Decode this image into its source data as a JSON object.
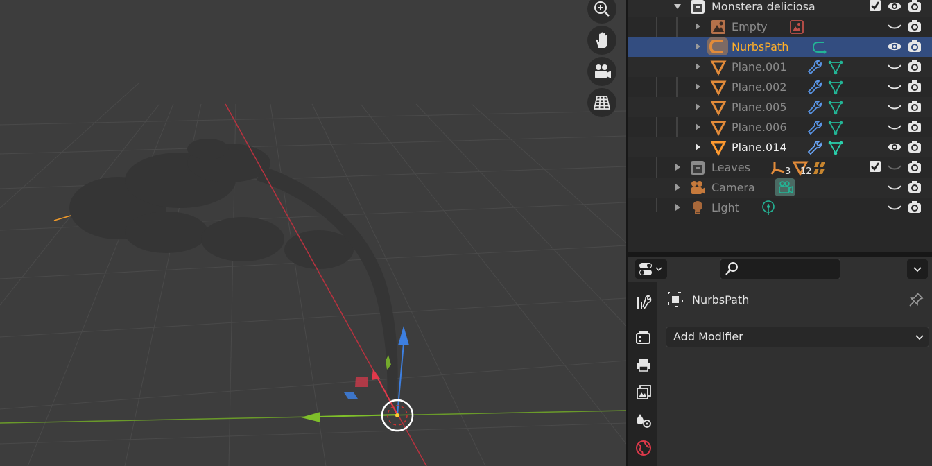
{
  "outliner": {
    "rows": [
      {
        "label": "Monstera deliciosa"
      },
      {
        "label": "Empty"
      },
      {
        "label": "NurbsPath"
      },
      {
        "label": "Plane.001"
      },
      {
        "label": "Plane.002"
      },
      {
        "label": "Plane.005"
      },
      {
        "label": "Plane.006"
      },
      {
        "label": "Plane.014"
      },
      {
        "label": "Leaves"
      },
      {
        "label": "Camera"
      },
      {
        "label": "Light"
      }
    ],
    "leaves_counts": {
      "modifiers": "3",
      "meshes": "12"
    }
  },
  "properties": {
    "object_name": "NurbsPath",
    "add_modifier_label": "Add Modifier"
  },
  "colors": {
    "active_text": "#ffaf29",
    "selected_row": "#334d80",
    "x_axis": "#e0394b",
    "y_axis": "#7fbf2a",
    "z_axis": "#3d7fe0",
    "mesh_icon": "#e28b3a",
    "modifier_icon": "#5a95e6",
    "data_icon": "#23b596"
  },
  "icons": {
    "viewport_nav": [
      "zoom-icon",
      "hand-pan-icon",
      "camera-view-icon",
      "grid-ortho-icon"
    ],
    "property_tabs": [
      "tool-icon",
      "render-icon",
      "output-icon",
      "view-layer-icon",
      "scene-icon",
      "world-icon"
    ]
  }
}
